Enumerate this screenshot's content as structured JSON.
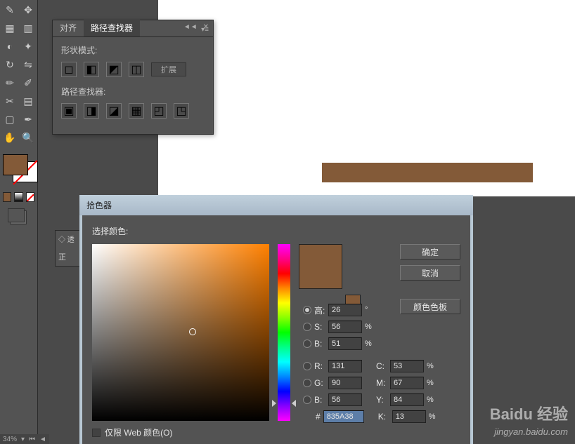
{
  "pathfinder": {
    "tab_align": "对齐",
    "tab_pathfinder": "路径查找器",
    "shape_modes_label": "形状模式:",
    "expand_label": "扩展",
    "pathfinders_label": "路径查找器:"
  },
  "transparency": {
    "tab": "◇ 透",
    "mode": "正"
  },
  "canvas": {
    "brown_color": "#835a38"
  },
  "color_picker": {
    "title": "拾色器",
    "select_color": "选择颜色:",
    "ok": "确定",
    "cancel": "取消",
    "swatches": "颜色色板",
    "hsb": {
      "h_label": "高:",
      "h_value": "26",
      "h_unit": "°",
      "s_label": "S:",
      "s_value": "56",
      "s_unit": "%",
      "b_label": "B:",
      "b_value": "51",
      "b_unit": "%"
    },
    "rgb": {
      "r_label": "R:",
      "r_value": "131",
      "g_label": "G:",
      "g_value": "90",
      "b_label": "B:",
      "b_value": "56"
    },
    "cmyk": {
      "c_label": "C:",
      "c_value": "53",
      "c_unit": "%",
      "m_label": "M:",
      "m_value": "67",
      "m_unit": "%",
      "y_label": "Y:",
      "y_value": "84",
      "y_unit": "%",
      "k_label": "K:",
      "k_value": "13",
      "k_unit": "%"
    },
    "hex_label": "#",
    "hex_value": "835A38",
    "web_only": "仅限 Web 颜色(O)"
  },
  "docbar": {
    "zoom": "34%"
  },
  "watermark": {
    "brand": "Baidu 经验",
    "url": "jingyan.baidu.com"
  }
}
